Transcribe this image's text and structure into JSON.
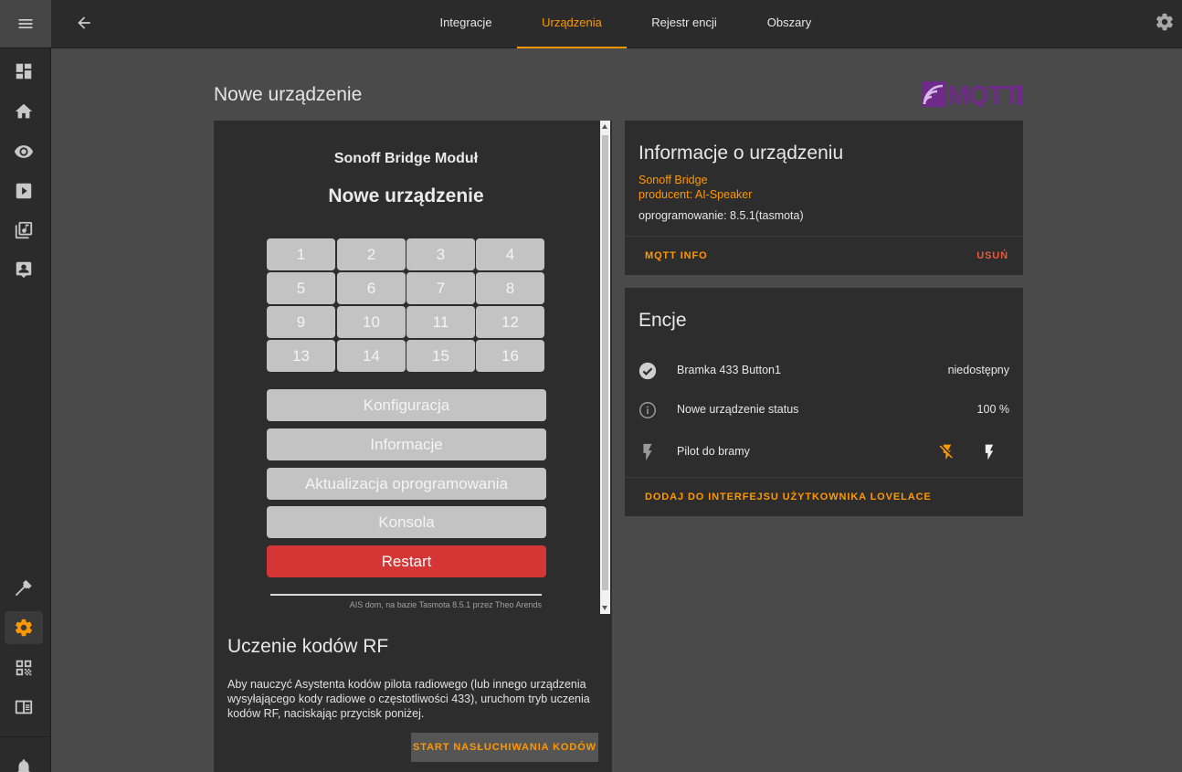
{
  "header": {
    "tabs": [
      {
        "label": "Integracje"
      },
      {
        "label": "Urządzenia"
      },
      {
        "label": "Rejestr encji"
      },
      {
        "label": "Obszary"
      }
    ]
  },
  "sidebar": {
    "items": [
      "menu-icon",
      "dashboard-icon",
      "home-icon",
      "eye-icon",
      "play-icon",
      "music-library-icon",
      "account-box-icon",
      "hammer-icon",
      "gear-icon",
      "qrcode-icon",
      "book-icon",
      "bell-icon"
    ]
  },
  "page": {
    "title": "Nowe urządzenie",
    "logo_text": "MQTT"
  },
  "frame": {
    "module": "Sonoff Bridge Moduł",
    "device": "Nowe urządzenie",
    "grid": [
      "1",
      "2",
      "3",
      "4",
      "5",
      "6",
      "7",
      "8",
      "9",
      "10",
      "11",
      "12",
      "13",
      "14",
      "15",
      "16"
    ],
    "config": "Konfiguracja",
    "info": "Informacje",
    "update": "Aktualizacja oprogramowania",
    "console": "Konsola",
    "restart": "Restart",
    "footer": "AIS dom, na bazie Tasmota 8.5.1 przez Theo Arends"
  },
  "rf": {
    "title": "Uczenie kodów RF",
    "text": "Aby nauczyć Asystenta kodów pilota radiowego (lub innego urządzenia wysyłającego kody radiowe o częstotliwości 433), uruchom tryb uczenia kodów RF, naciskając przycisk poniżej.",
    "button": "START NASŁUCHIWANIA KODÓW"
  },
  "info_card": {
    "title": "Informacje o urządzeniu",
    "model": "Sonoff Bridge",
    "manufacturer": "producent: AI-Speaker",
    "firmware": "oprogramowanie: 8.5.1(tasmota)",
    "mqtt_info": "MQTT INFO",
    "delete": "USUŃ"
  },
  "entities": {
    "title": "Encje",
    "rows": [
      {
        "name": "Bramka 433 Button1",
        "state": "niedostępny"
      },
      {
        "name": "Nowe urządzenie status",
        "state": "100 %"
      },
      {
        "name": "Pilot do bramy",
        "state": ""
      }
    ],
    "add_lovelace": "DODAJ DO INTERFEJSU UŻYTKOWNIKA LOVELACE"
  },
  "colors": {
    "accent": "#ff9800",
    "restart": "#d43535",
    "background": "#4a4a4a",
    "card": "#2d2d2d"
  }
}
